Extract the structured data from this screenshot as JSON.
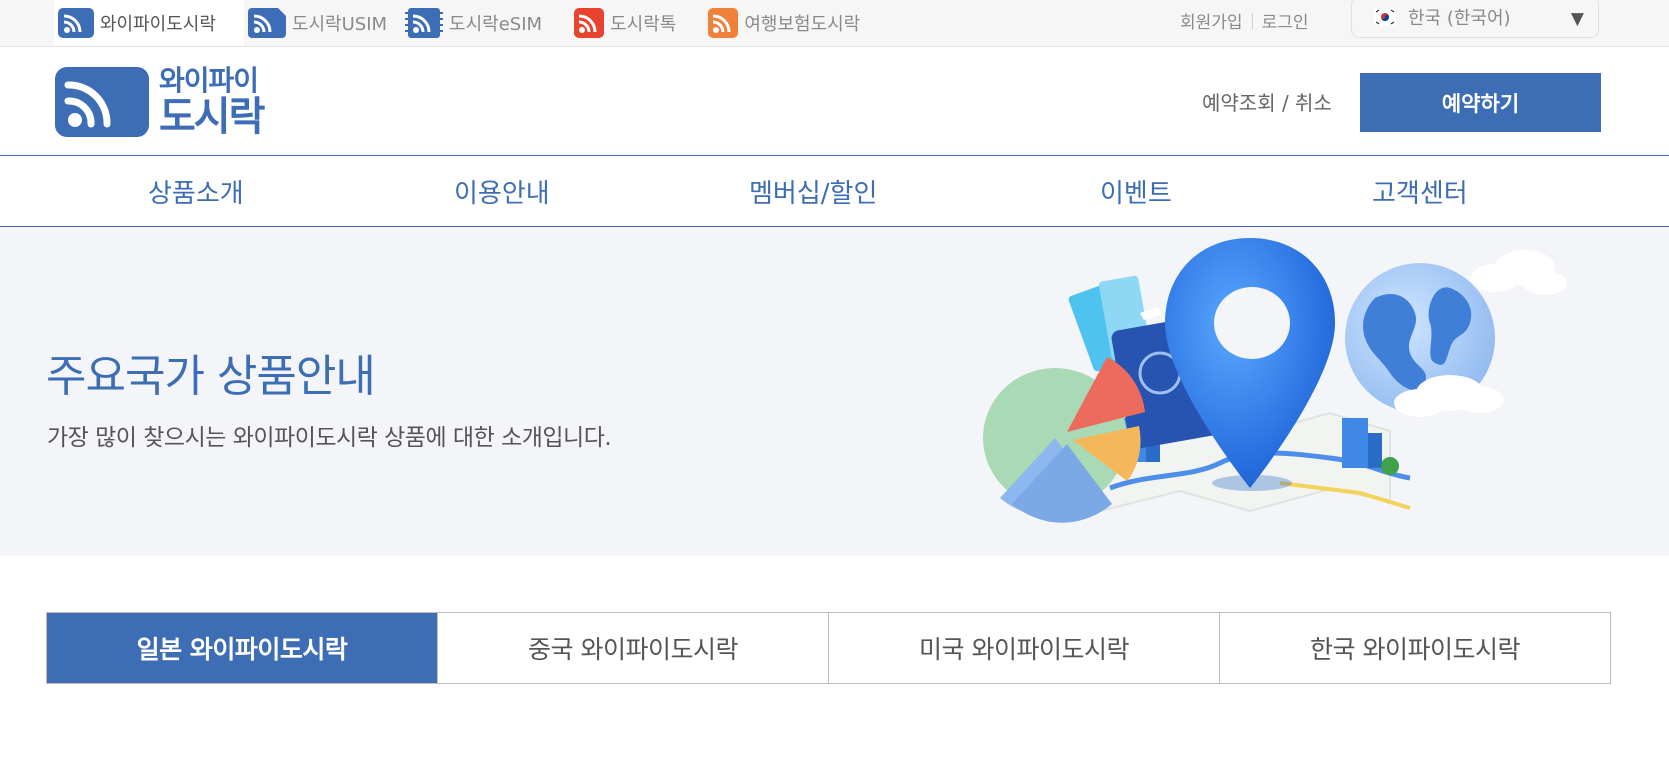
{
  "topbar": {
    "brands": [
      {
        "label": "와이파이도시락",
        "icon": "wifi-icon",
        "color": "#3d6db5"
      },
      {
        "label": "도시락USIM",
        "icon": "usim-icon",
        "color": "#3d6db5"
      },
      {
        "label": "도시락eSIM",
        "icon": "esim-icon",
        "color": "#3d6db5"
      },
      {
        "label": "도시락톡",
        "icon": "talk-icon",
        "color": "#e8432e"
      },
      {
        "label": "여행보험도시락",
        "icon": "insurance-icon",
        "color": "#f0813b"
      }
    ],
    "signup": "회원가입",
    "login": "로그인",
    "language": "한국 (한국어)"
  },
  "header": {
    "logo_line1": "와이파이",
    "logo_line2": "도시락",
    "lookup_cancel": "예약조회 / 취소",
    "reserve_button": "예약하기"
  },
  "nav": {
    "items": [
      "상품소개",
      "이용안내",
      "멤버십/할인",
      "이벤트",
      "고객센터"
    ]
  },
  "hero": {
    "title": "주요국가 상품안내",
    "subtitle": "가장 많이 찾으시는 와이파이도시락 상품에 대한 소개입니다."
  },
  "tabs": {
    "items": [
      "일본 와이파이도시락",
      "중국 와이파이도시락",
      "미국 와이파이도시락",
      "한국 와이파이도시락"
    ],
    "active_index": 0
  },
  "colors": {
    "brand_blue": "#3d6db5",
    "hero_bg": "#f4f5f9"
  }
}
